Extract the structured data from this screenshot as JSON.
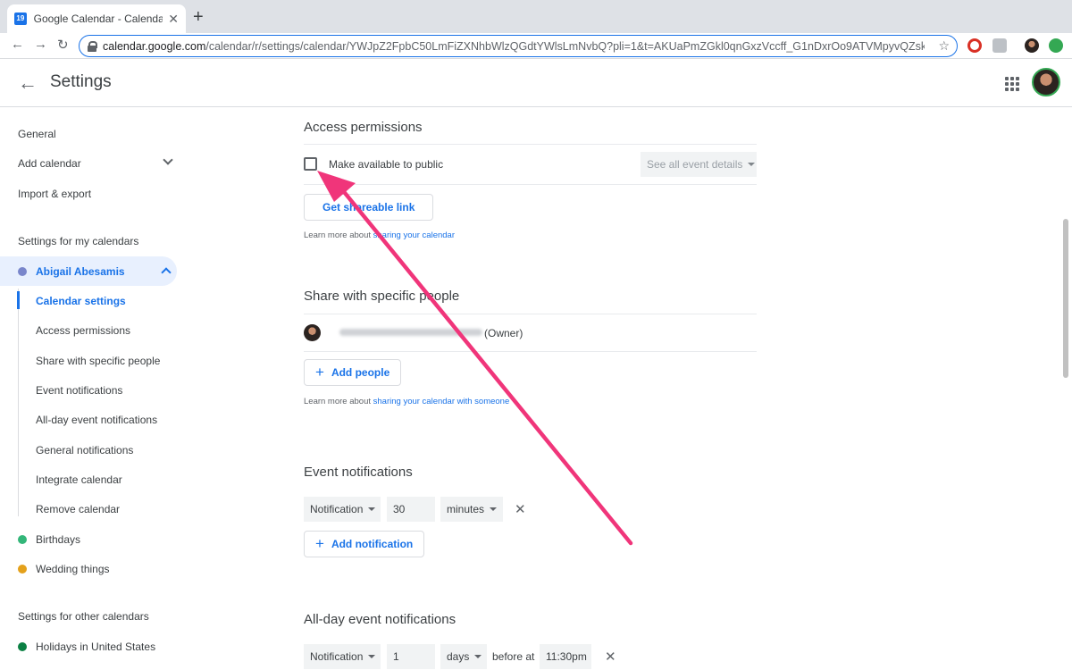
{
  "browser": {
    "tab_title": "Google Calendar - Calendar se",
    "favicon_text": "19",
    "new_tab": "+",
    "tab_close": "✕",
    "url_host": "calendar.google.com",
    "url_path": "/calendar/r/settings/calendar/YWJpZ2FpbC50LmFiZXNhbWlzQGdtYWlsLmNvbQ?pli=1&t=AKUaPmZGkl0qnGxzVccff_G1nDxrOo9ATVMpyvQZsk...",
    "back": "←",
    "forward": "→",
    "reload": "↻",
    "star": "☆"
  },
  "header": {
    "back_icon": "←",
    "title": "Settings"
  },
  "sidebar": {
    "top_items": [
      {
        "label": "General"
      },
      {
        "label": "Add calendar"
      },
      {
        "label": "Import & export"
      }
    ],
    "my_calendars_heading": "Settings for my calendars",
    "active_calendar": {
      "label": "Abigail Abesamis",
      "color": "#7986cb"
    },
    "sub_items": [
      {
        "label": "Calendar settings"
      },
      {
        "label": "Access permissions"
      },
      {
        "label": "Share with specific people"
      },
      {
        "label": "Event notifications"
      },
      {
        "label": "All-day event notifications"
      },
      {
        "label": "General notifications"
      },
      {
        "label": "Integrate calendar"
      },
      {
        "label": "Remove calendar"
      }
    ],
    "other_my_calendars": [
      {
        "label": "Birthdays",
        "color": "#33b679"
      },
      {
        "label": "Wedding things",
        "color": "#e4a11b"
      }
    ],
    "other_calendars_heading": "Settings for other calendars",
    "other_calendars": [
      {
        "label": "Holidays in United States",
        "color": "#0b8043"
      }
    ]
  },
  "access_permissions": {
    "heading": "Access permissions",
    "public_checkbox_label": "Make available to public",
    "public_checked": false,
    "detail_select": "See all event details",
    "shareable_link_button": "Get shareable link",
    "learn_more_prefix": "Learn more about ",
    "learn_more_link": "sharing your calendar"
  },
  "share_people": {
    "heading": "Share with specific people",
    "owner_label": "(Owner)",
    "add_people_button": "Add people",
    "learn_more_prefix": "Learn more about ",
    "learn_more_link": "sharing your calendar with someone"
  },
  "event_notifications": {
    "heading": "Event notifications",
    "type": "Notification",
    "amount": "30",
    "unit": "minutes",
    "add_button": "Add notification"
  },
  "allday_notifications": {
    "heading": "All-day event notifications",
    "type": "Notification",
    "amount": "1",
    "unit": "days",
    "before_at": "before at",
    "time": "11:30pm"
  },
  "annotation": {
    "arrow_color": "#f0357a"
  }
}
